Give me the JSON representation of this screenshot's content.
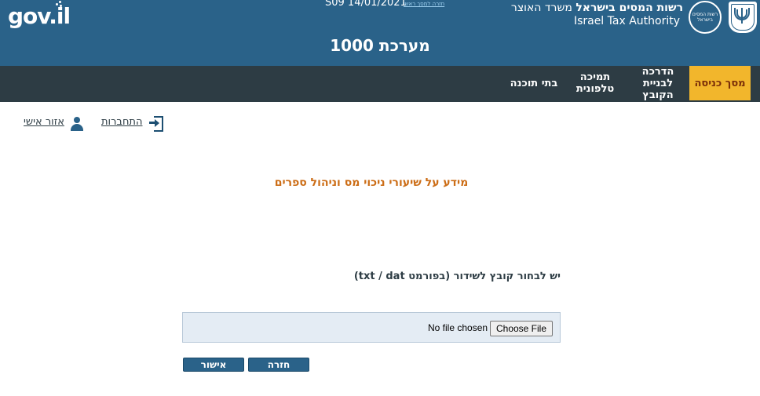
{
  "header": {
    "gov_logo": "gov.il",
    "version_text": "S09 14/01/2021",
    "tiny_link": "חזרה למסך ראשי",
    "system_title": "מערכת 1000",
    "authority_he_bold": "רשות המסים בישראל",
    "authority_he_rest": " משרד האוצר",
    "authority_en": "Israel Tax Authority",
    "emblem_text": "רשות המסים בישראל",
    "colors": {
      "header_bg": "#2a6289",
      "nav_bg": "#2d3c44",
      "active_tab": "#f2b62c",
      "accent_text": "#cc6d16"
    },
    "icons": [
      "tax-authority-emblem-icon",
      "state-emblem-menorah-icon"
    ]
  },
  "nav": {
    "items": [
      {
        "label": "מסך כניסה",
        "active": true
      },
      {
        "label": "הדרכה לבניית הקובץ",
        "active": false
      },
      {
        "label": "תמיכה טלפונית",
        "active": false
      },
      {
        "label": "בתי תוכנה",
        "active": false
      }
    ]
  },
  "user_links": {
    "login": "התחברות",
    "personal_area": "אזור אישי",
    "icons": [
      "login-icon",
      "user-icon"
    ]
  },
  "main": {
    "info_title": "מידע על שיעורי ניכוי מס וניהול ספרים",
    "file_label": "יש לבחור קובץ לשידור (בפורמט txt / dat)",
    "file_input": {
      "button_label": "Choose File",
      "status": "No file chosen"
    },
    "back_button": "חזרה",
    "confirm_button": "אישור"
  }
}
